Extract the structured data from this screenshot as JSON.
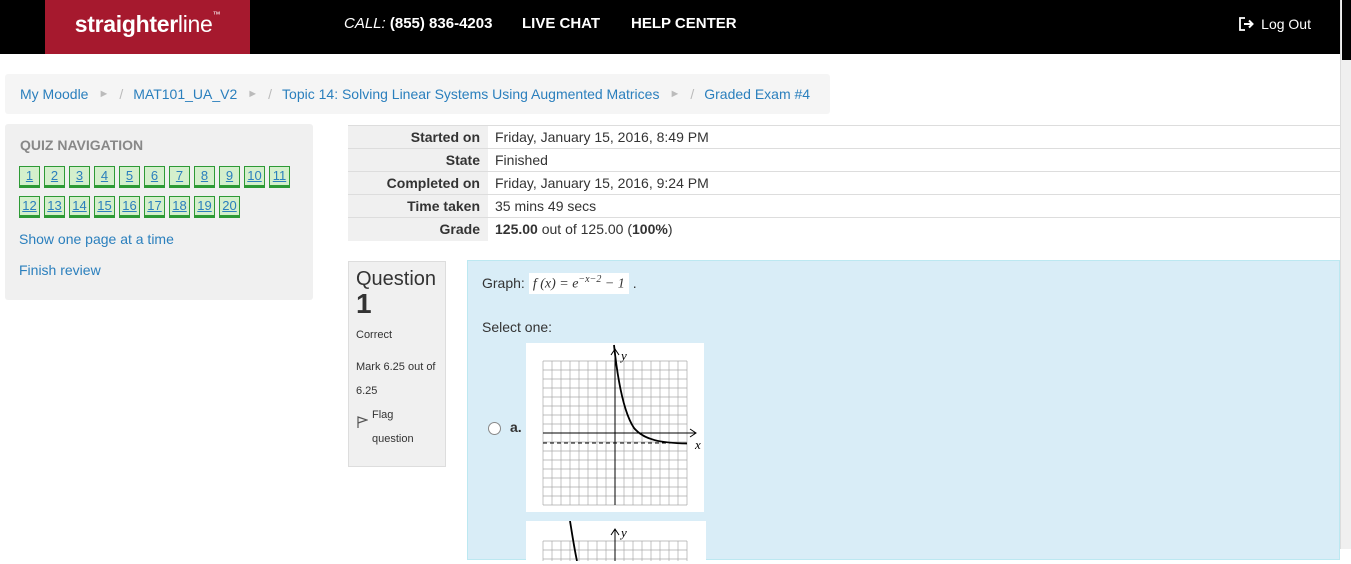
{
  "header": {
    "logo_bold": "straighter",
    "logo_light": "line",
    "logo_tm": "™",
    "call_label": "CALL:",
    "phone": "(855) 836-4203",
    "live_chat": "LIVE CHAT",
    "help_center": "HELP CENTER",
    "logout": "Log Out"
  },
  "breadcrumb": {
    "items": [
      "My Moodle",
      "MAT101_UA_V2",
      "Topic 14: Solving Linear Systems Using Augmented Matrices",
      "Graded Exam #4"
    ]
  },
  "quiz_nav": {
    "title": "QUIZ NAVIGATION",
    "questions": [
      "1",
      "2",
      "3",
      "4",
      "5",
      "6",
      "7",
      "8",
      "9",
      "10",
      "11",
      "12",
      "13",
      "14",
      "15",
      "16",
      "17",
      "18",
      "19",
      "20"
    ],
    "show_one_page": "Show one page at a time",
    "finish_review": "Finish review"
  },
  "summary": {
    "rows": [
      {
        "label": "Started on",
        "value": "Friday, January 15, 2016, 8:49 PM"
      },
      {
        "label": "State",
        "value": "Finished"
      },
      {
        "label": "Completed on",
        "value": "Friday, January 15, 2016, 9:24 PM"
      },
      {
        "label": "Time taken",
        "value": "35 mins 49 secs"
      }
    ],
    "grade_label": "Grade",
    "grade_score": "125.00",
    "grade_mid": " out of 125.00 (",
    "grade_pct": "100%",
    "grade_end": ")"
  },
  "question": {
    "label": "Question",
    "number": "1",
    "status": "Correct",
    "mark": "Mark 6.25 out of 6.25",
    "flag": "Flag question",
    "prompt": "Graph:",
    "formula_main": "f (x) = e",
    "formula_exp": "−x−2",
    "formula_tail": " − 1",
    "period": ".",
    "select_one": "Select one:",
    "options": [
      {
        "letter": "a."
      }
    ],
    "axis_x": "x",
    "axis_y": "y"
  },
  "colors": {
    "brand_red": "#a6192e",
    "link_blue": "#2a7fbd",
    "correct_green": "#2d9a35",
    "question_bg": "#d9edf7"
  }
}
